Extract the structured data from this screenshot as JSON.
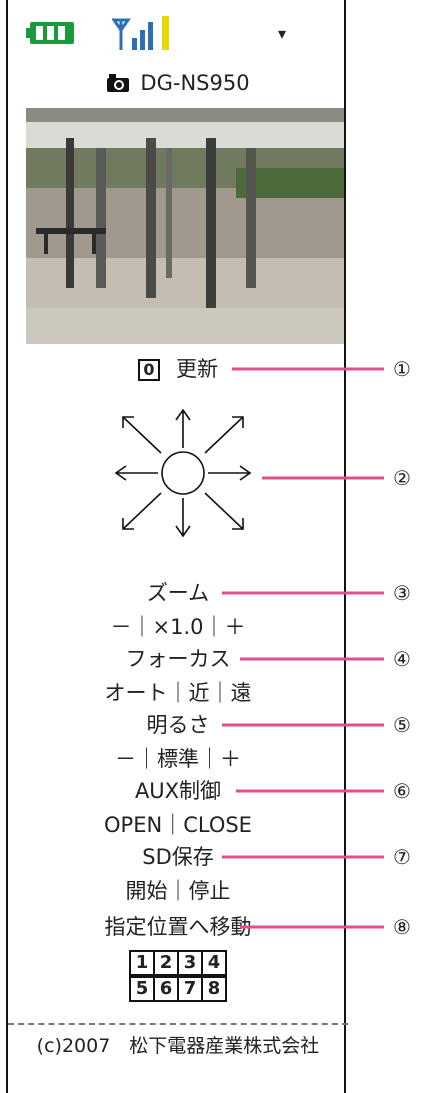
{
  "status_bar": {
    "battery_icon": "battery-full-icon",
    "signal_icon": "antenna-signal-icon",
    "menu_indicator": "▾"
  },
  "header": {
    "camera_icon": "camera-icon",
    "title": "DG-NS950"
  },
  "camera_image": {
    "description_icon": "camera-snapshot"
  },
  "refresh": {
    "key": "0",
    "label": "更新"
  },
  "pan_tilt_pad": {
    "icon": "direction-pad-icon"
  },
  "zoom": {
    "label": "ズーム",
    "controls": "－｜×1.0｜＋"
  },
  "focus": {
    "label": "フォーカス",
    "controls": "オート｜近｜遠"
  },
  "brightness": {
    "label": "明るさ",
    "controls": "－｜標準｜＋"
  },
  "aux": {
    "label": "AUX制御",
    "controls": "OPEN｜CLOSE"
  },
  "sd": {
    "label": "SD保存",
    "controls": "開始｜停止"
  },
  "preset": {
    "label": "指定位置へ移動",
    "row1": [
      "1",
      "2",
      "3",
      "4"
    ],
    "row2": [
      "5",
      "6",
      "7",
      "8"
    ]
  },
  "footer": {
    "copyright": "(c)2007　松下電器産業株式会社"
  },
  "callouts": [
    "①",
    "②",
    "③",
    "④",
    "⑤",
    "⑥",
    "⑦",
    "⑧"
  ],
  "colors": {
    "battery": "#1a9a3a",
    "signal_bar": "#e8d800",
    "callout_line": "#e44d8c"
  }
}
